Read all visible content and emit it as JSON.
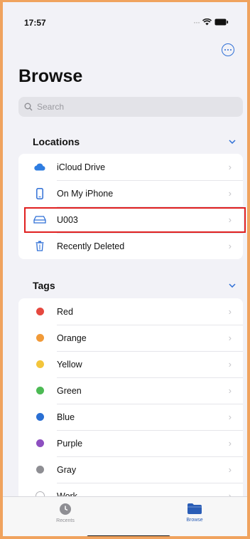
{
  "status": {
    "time": "17:57",
    "dots": "···"
  },
  "header": {
    "title": "Browse"
  },
  "search": {
    "placeholder": "Search"
  },
  "locations": {
    "label": "Locations",
    "items": [
      {
        "label": "iCloud Drive",
        "icon": "cloud-icon"
      },
      {
        "label": "On My iPhone",
        "icon": "phone-icon"
      },
      {
        "label": "U003",
        "icon": "drive-icon"
      },
      {
        "label": "Recently Deleted",
        "icon": "trash-icon"
      }
    ]
  },
  "tags": {
    "label": "Tags",
    "items": [
      {
        "label": "Red",
        "color": "#e5483f"
      },
      {
        "label": "Orange",
        "color": "#f19a38"
      },
      {
        "label": "Yellow",
        "color": "#f3c53b"
      },
      {
        "label": "Green",
        "color": "#4cba54"
      },
      {
        "label": "Blue",
        "color": "#2a6fd3"
      },
      {
        "label": "Purple",
        "color": "#8d4fc0"
      },
      {
        "label": "Gray",
        "color": "#8e8e93"
      },
      {
        "label": "Work",
        "color": "#ffffff"
      }
    ]
  },
  "tabbar": {
    "recents": "Recents",
    "browse": "Browse"
  },
  "colors": {
    "accent": "#2f6fd6",
    "highlight": "#e02020",
    "frame": "#f0a35e"
  }
}
